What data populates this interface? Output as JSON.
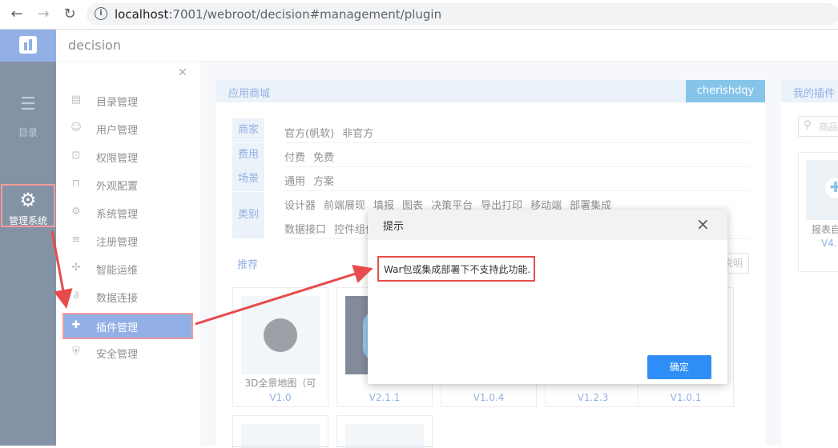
{
  "browser": {
    "back_icon": "back-arrow-icon",
    "forward_icon": "forward-arrow-icon",
    "reload_icon": "reload-icon",
    "info_icon": "info-icon",
    "url_host": "localhost",
    "url_rest": ":7001/webroot/decision#management/plugin"
  },
  "leftnav": {
    "catalog_label": "目录",
    "management_label": "管理系统",
    "accent_color": "#3a6fcf",
    "bg_color": "#1f3a5c"
  },
  "header": {
    "title": "decision"
  },
  "submenu": {
    "items": [
      {
        "label": "目录管理",
        "icon": "catalog-icon"
      },
      {
        "label": "用户管理",
        "icon": "user-icon"
      },
      {
        "label": "权限管理",
        "icon": "lock-icon"
      },
      {
        "label": "外观配置",
        "icon": "paint-roller-icon"
      },
      {
        "label": "系统管理",
        "icon": "gear-icon"
      },
      {
        "label": "注册管理",
        "icon": "register-icon"
      },
      {
        "label": "智能运维",
        "icon": "network-icon"
      },
      {
        "label": "数据连接",
        "icon": "link-icon"
      },
      {
        "label": "插件管理",
        "icon": "puzzle-icon"
      },
      {
        "label": "安全管理",
        "icon": "shield-icon"
      }
    ]
  },
  "store": {
    "tab_label": "应用商城",
    "user": "cherishdqy",
    "filters": {
      "merchant_key": "商家",
      "merchant_values": [
        "官方(帆软)",
        "非官方"
      ],
      "fee_key": "费用",
      "fee_values": [
        "付费",
        "免费"
      ],
      "scene_key": "场景",
      "scene_values": [
        "通用",
        "方案"
      ],
      "type_key": "类别",
      "type_values_row1": [
        "设计器",
        "前端展现",
        "填报",
        "图表",
        "决策平台",
        "导出打印",
        "移动端",
        "部署集成"
      ],
      "type_values_row2": [
        "数据接口",
        "控件组件"
      ]
    },
    "recommend_label": "推荐",
    "desc_button": "说明",
    "cards": [
      {
        "name": "3D全景地图（可",
        "version": "V1.0"
      },
      {
        "name": "",
        "version": "V2.1.1"
      },
      {
        "name": "",
        "version": "V1.0.4"
      },
      {
        "name": "",
        "version": "V1.2.3"
      },
      {
        "name": "",
        "version": "V1.0.1"
      }
    ]
  },
  "my_plugins": {
    "tab_label": "我的插件",
    "search_placeholder": "商品",
    "card_name": "报表自",
    "card_version": "V4."
  },
  "dialog": {
    "title": "提示",
    "message": "War包或集成部署下不支持此功能.",
    "ok_label": "确定",
    "ok_color": "#2f8ef5"
  },
  "annotation_color": "#e74b4b"
}
